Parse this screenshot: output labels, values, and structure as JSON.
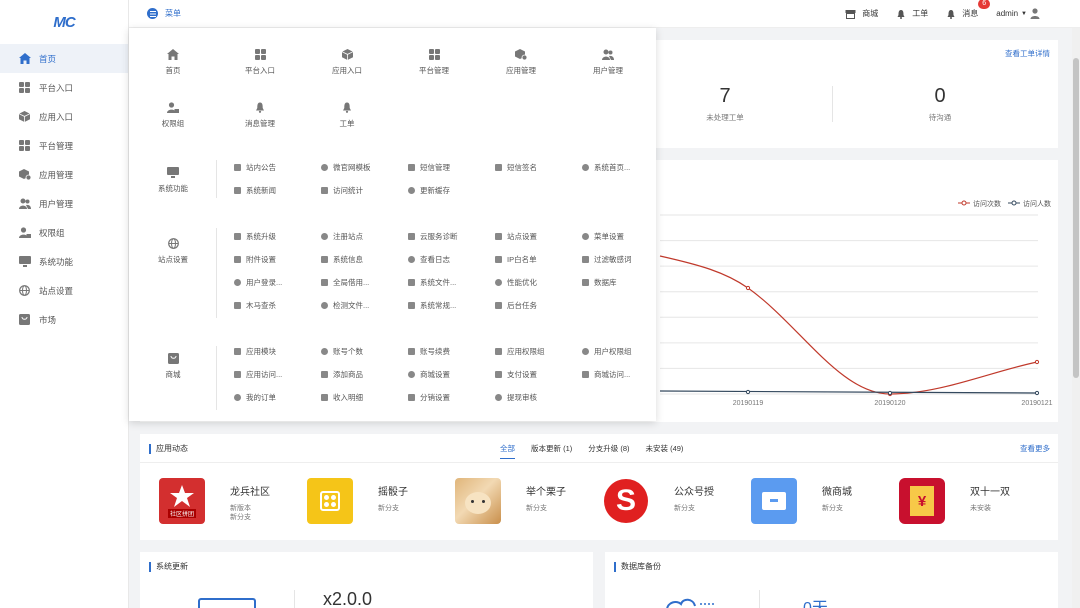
{
  "logo": "MC",
  "sidebar": {
    "items": [
      {
        "label": "首页",
        "icon": "home-icon"
      },
      {
        "label": "平台入口",
        "icon": "grid-icon"
      },
      {
        "label": "应用入口",
        "icon": "cube-icon"
      },
      {
        "label": "平台管理",
        "icon": "grid-icon"
      },
      {
        "label": "应用管理",
        "icon": "cube-gear-icon"
      },
      {
        "label": "用户管理",
        "icon": "users-icon"
      },
      {
        "label": "权限组",
        "icon": "user-lock-icon"
      },
      {
        "label": "系统功能",
        "icon": "monitor-icon"
      },
      {
        "label": "站点设置",
        "icon": "globe-icon"
      },
      {
        "label": "市场",
        "icon": "shop-icon"
      }
    ]
  },
  "topbar": {
    "menu": "菜单",
    "shop": "商城",
    "ticket": "工单",
    "messages": "消息",
    "badge": "6",
    "user": "admin"
  },
  "stats": {
    "view_link": "查看工单详情",
    "pending": {
      "num": "7",
      "label": "未处理工单"
    },
    "talk": {
      "num": "0",
      "label": "待沟通"
    }
  },
  "chart_data": {
    "type": "line",
    "x": [
      "20190119",
      "20190120",
      "20190121"
    ],
    "series": [
      {
        "name": "访问次数",
        "color": "#c0392b",
        "values": [
          null,
          0,
          null
        ]
      },
      {
        "name": "访问人数",
        "color": "#34495e",
        "values": [
          null,
          0,
          null
        ]
      }
    ],
    "legend": "top-right"
  },
  "apps": {
    "title": "应用动态",
    "tabs": [
      "全部",
      "版本更新 (1)",
      "分支升级 (8)",
      "未安装 (49)"
    ],
    "more": "查看更多",
    "list": [
      {
        "name": "龙兵社区",
        "sub": "新版本",
        "sub2": "新分支",
        "badge": "社区拼团"
      },
      {
        "name": "摇骰子",
        "sub": "新分支",
        "sub2": ""
      },
      {
        "name": "举个栗子",
        "sub": "新分支",
        "sub2": ""
      },
      {
        "name": "公众号授",
        "sub": "新分支",
        "sub2": ""
      },
      {
        "name": "微商城",
        "sub": "新分支",
        "sub2": ""
      },
      {
        "name": "双十一双",
        "sub": "未安装",
        "sub2": ""
      }
    ]
  },
  "sysupdate": {
    "title": "系统更新",
    "version": "x2.0.0"
  },
  "backup": {
    "title": "数据库备份",
    "days": "0天"
  },
  "dropdown": {
    "top": [
      {
        "label": "首页"
      },
      {
        "label": "平台入口"
      },
      {
        "label": "应用入口"
      },
      {
        "label": "平台管理"
      },
      {
        "label": "应用管理"
      },
      {
        "label": "用户管理"
      },
      {
        "label": "权限组"
      },
      {
        "label": "消息管理"
      },
      {
        "label": "工单"
      }
    ],
    "sections": [
      {
        "label": "系统功能",
        "items": [
          "站内公告",
          "微官网模板",
          "短信管理",
          "短信签名",
          "系统首页...",
          "系统新闻",
          "访问统计",
          "更新缓存"
        ]
      },
      {
        "label": "站点设置",
        "items": [
          "系统升级",
          "注册站点",
          "云服务诊断",
          "站点设置",
          "菜单设置",
          "附件设置",
          "系统信息",
          "查看日志",
          "IP白名单",
          "过滤敏感词",
          "用户登录...",
          "全局借用...",
          "系统文件...",
          "性能优化",
          "数据库",
          "木马查杀",
          "检测文件...",
          "系统常规...",
          "后台任务"
        ]
      },
      {
        "label": "商城",
        "items": [
          "应用模块",
          "账号个数",
          "账号续费",
          "应用权限组",
          "用户权限组",
          "应用访问...",
          "添加商品",
          "商城设置",
          "支付设置",
          "商城访问...",
          "我的订单",
          "收入明细",
          "分销设置",
          "提现审核"
        ]
      }
    ]
  }
}
